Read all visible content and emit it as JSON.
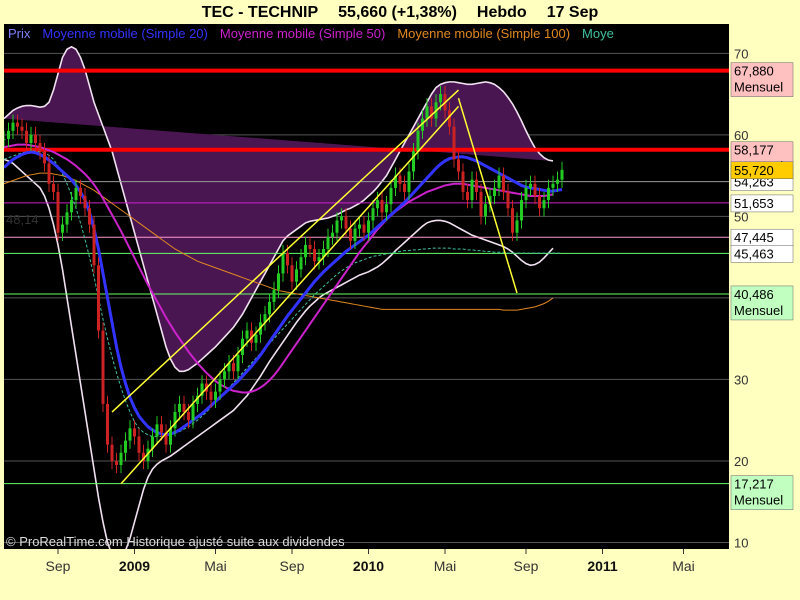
{
  "header": {
    "symbol": "TEC - TECHNIP",
    "quote": "55,660 (+1,38%)",
    "period": "Hebdo",
    "date": "17 Sep"
  },
  "legend": [
    {
      "label": "Prix",
      "color": "#8080FF"
    },
    {
      "label": "Moyenne mobile (Simple 20)",
      "color": "#3333FF"
    },
    {
      "label": "Moyenne mobile (Simple 50)",
      "color": "#CC22CC"
    },
    {
      "label": "Moyenne mobile (Simple 100)",
      "color": "#E08820"
    },
    {
      "label": "Moye",
      "color": "#40C0A0"
    }
  ],
  "footer": {
    "credit": "© ProRealTime.com Historique ajusté suite aux dividendes"
  },
  "colors": {
    "background": "#000000",
    "axis_bg": "#FFFFC0",
    "bollinger_fill": "#4A1652",
    "bollinger_edge": "#F0E0F0",
    "up": "#22CC22",
    "down": "#CC2222",
    "channel": "#FFFF33",
    "resistance": "#FF0000"
  },
  "chart_data": {
    "type": "candlestick",
    "ylim": [
      9.2,
      73.6
    ],
    "yticks": [
      10,
      20,
      30,
      40,
      50,
      60,
      70
    ],
    "xticks": [
      {
        "label": "Sep",
        "i": 12,
        "bold": false
      },
      {
        "label": "2009",
        "i": 29,
        "bold": true
      },
      {
        "label": "Mai",
        "i": 47,
        "bold": false
      },
      {
        "label": "Sep",
        "i": 64,
        "bold": false
      },
      {
        "label": "2010",
        "i": 81,
        "bold": true
      },
      {
        "label": "Mai",
        "i": 98,
        "bold": false
      },
      {
        "label": "Sep",
        "i": 116,
        "bold": false
      },
      {
        "label": "2011",
        "i": 133,
        "bold": true
      },
      {
        "label": "Mai",
        "i": 151,
        "bold": false
      }
    ],
    "prices": [
      59.5,
      60.5,
      61.5,
      61.0,
      60.5,
      59.0,
      60.0,
      59.0,
      58.0,
      56.5,
      54.0,
      53.0,
      48.0,
      49.0,
      50.5,
      52.0,
      53.5,
      52.5,
      51.0,
      49.0,
      44.0,
      36.0,
      27.0,
      22.0,
      20.0,
      19.5,
      21.0,
      22.5,
      24.0,
      23.0,
      21.0,
      20.0,
      21.5,
      23.0,
      24.5,
      23.5,
      22.0,
      24.0,
      26.0,
      27.0,
      26.0,
      25.0,
      27.0,
      28.0,
      29.5,
      28.5,
      27.5,
      28.5,
      30.0,
      31.0,
      32.0,
      31.0,
      33.0,
      35.0,
      36.0,
      34.5,
      35.5,
      37.0,
      38.0,
      39.5,
      41.0,
      43.0,
      45.5,
      44.0,
      42.0,
      43.5,
      45.0,
      46.5,
      46.0,
      44.5,
      45.0,
      46.0,
      47.5,
      48.0,
      49.5,
      50.0,
      48.5,
      47.0,
      48.5,
      49.0,
      48.0,
      49.5,
      51.0,
      52.0,
      50.5,
      51.5,
      53.5,
      55.0,
      54.0,
      53.0,
      55.5,
      58.0,
      60.5,
      62.0,
      63.5,
      62.0,
      64.0,
      65.0,
      63.0,
      61.0,
      57.0,
      55.5,
      53.0,
      52.0,
      54.5,
      53.0,
      50.0,
      51.5,
      52.5,
      53.5,
      55.0,
      53.0,
      51.0,
      48.0,
      49.5,
      52.0,
      53.5,
      54.0,
      52.5,
      51.0,
      52.0,
      53.5,
      54.0,
      54.5,
      55.7
    ],
    "sma20": [
      56.0,
      56.5,
      57.0,
      57.3,
      57.6,
      57.8,
      57.9,
      57.8,
      57.6,
      57.3,
      56.9,
      56.5,
      56.0,
      55.5,
      55.0,
      54.5,
      53.8,
      53.0,
      52.0,
      50.5,
      48.5,
      46.0,
      43.0,
      40.0,
      37.0,
      34.0,
      31.5,
      29.5,
      27.8,
      26.5,
      25.5,
      24.8,
      24.2,
      23.8,
      23.5,
      23.3,
      23.2,
      23.3,
      23.5,
      23.8,
      24.2,
      24.6,
      25.0,
      25.4,
      25.8,
      26.3,
      26.8,
      27.3,
      27.8,
      28.3,
      28.8,
      29.3,
      29.8,
      30.4,
      31.0,
      31.6,
      32.3,
      33.0,
      33.8,
      34.6,
      35.4,
      36.2,
      37.0,
      37.8,
      38.5,
      39.2,
      39.9,
      40.6,
      41.3,
      42.0,
      42.6,
      43.2,
      43.7,
      44.2,
      44.7,
      45.2,
      45.7,
      46.1,
      46.5,
      46.9,
      47.3,
      47.7,
      48.2,
      48.7,
      49.2,
      49.7,
      50.2,
      50.7,
      51.2,
      51.7,
      52.3,
      52.9,
      53.5,
      54.1,
      54.7,
      55.3,
      55.9,
      56.4,
      56.8,
      57.1,
      57.2,
      57.3,
      57.3,
      57.2,
      57.0,
      56.8,
      56.5,
      56.2,
      55.9,
      55.6,
      55.3,
      55.0,
      54.7,
      54.4,
      54.1,
      53.8,
      53.6,
      53.5,
      53.4,
      53.3,
      53.2,
      53.1,
      53.1,
      53.2,
      53.3
    ],
    "sma50": [
      58.5,
      58.6,
      58.7,
      58.8,
      58.8,
      58.8,
      58.7,
      58.6,
      58.5,
      58.3,
      58.1,
      57.9,
      57.6,
      57.3,
      57.0,
      56.6,
      56.2,
      55.7,
      55.2,
      54.6,
      53.9,
      53.1,
      52.2,
      51.2,
      50.2,
      49.2,
      48.2,
      47.1,
      46.0,
      44.9,
      43.8,
      42.7,
      41.6,
      40.6,
      39.6,
      38.6,
      37.6,
      36.7,
      35.8,
      35.0,
      34.2,
      33.4,
      32.7,
      32.0,
      31.4,
      30.8,
      30.3,
      29.8,
      29.4,
      29.1,
      28.8,
      28.6,
      28.5,
      28.4,
      28.4,
      28.5,
      28.7,
      29.0,
      29.4,
      29.9,
      30.5,
      31.2,
      32.0,
      32.8,
      33.6,
      34.4,
      35.2,
      36.0,
      36.8,
      37.6,
      38.4,
      39.2,
      40.0,
      40.8,
      41.6,
      42.4,
      43.2,
      44.0,
      44.8,
      45.6,
      46.3,
      47.0,
      47.7,
      48.4,
      49.0,
      49.6,
      50.1,
      50.6,
      51.0,
      51.4,
      51.8,
      52.1,
      52.4,
      52.7,
      53.0,
      53.2,
      53.4,
      53.6,
      53.8,
      53.9,
      54.0,
      54.0,
      54.0,
      53.9,
      53.8,
      53.7,
      53.6,
      53.5,
      53.4,
      53.3,
      53.2,
      53.1,
      53.0,
      52.9,
      52.8,
      52.7,
      52.6,
      52.5,
      52.5,
      52.5,
      52.5,
      52.6,
      52.7
    ],
    "sma100": [
      54.0,
      54.2,
      54.4,
      54.6,
      54.8,
      55.0,
      55.1,
      55.2,
      55.3,
      55.3,
      55.3,
      55.2,
      55.1,
      55.0,
      54.8,
      54.6,
      54.4,
      54.1,
      53.8,
      53.5,
      53.2,
      52.8,
      52.4,
      52.0,
      51.6,
      51.2,
      50.8,
      50.4,
      50.0,
      49.6,
      49.2,
      48.8,
      48.4,
      48.0,
      47.6,
      47.2,
      46.8,
      46.4,
      46.0,
      45.7,
      45.4,
      45.1,
      44.8,
      44.5,
      44.3,
      44.1,
      43.9,
      43.7,
      43.5,
      43.3,
      43.1,
      42.9,
      42.7,
      42.5,
      42.3,
      42.1,
      41.9,
      41.7,
      41.5,
      41.3,
      41.1,
      40.9,
      40.8,
      40.7,
      40.6,
      40.5,
      40.4,
      40.3,
      40.2,
      40.1,
      40.0,
      39.9,
      39.8,
      39.7,
      39.6,
      39.5,
      39.4,
      39.3,
      39.2,
      39.1,
      39.0,
      38.9,
      38.8,
      38.7,
      38.6,
      38.6,
      38.6,
      38.6,
      38.6,
      38.6,
      38.6,
      38.6,
      38.6,
      38.6,
      38.6,
      38.6,
      38.6,
      38.6,
      38.6,
      38.6,
      38.6,
      38.6,
      38.6,
      38.6,
      38.6,
      38.6,
      38.6,
      38.6,
      38.6,
      38.6,
      38.6,
      38.5,
      38.5,
      38.5,
      38.5,
      38.6,
      38.7,
      38.8,
      38.9,
      39.1,
      39.3,
      39.6,
      40.0
    ],
    "ma_other": [
      57.0,
      57.2,
      57.4,
      57.6,
      57.8,
      57.9,
      58.0,
      58.0,
      57.9,
      57.8,
      57.5,
      57.0,
      56.2,
      55.2,
      54.0,
      52.6,
      51.0,
      49.2,
      47.2,
      45.0,
      42.6,
      40.0,
      37.4,
      35.0,
      32.8,
      30.8,
      29.0,
      27.4,
      26.0,
      24.8,
      24.0,
      23.5,
      23.2,
      23.0,
      23.0,
      23.0,
      23.1,
      23.2,
      23.4,
      23.6,
      23.9,
      24.2,
      24.6,
      25.0,
      25.5,
      26.0,
      26.6,
      27.2,
      27.8,
      28.4,
      29.0,
      29.6,
      30.2,
      30.8,
      31.4,
      32.0,
      32.6,
      33.2,
      33.8,
      34.4,
      35.0,
      35.6,
      36.2,
      36.8,
      37.4,
      38.0,
      38.6,
      39.2,
      39.8,
      40.4,
      40.9,
      41.4,
      41.9,
      42.4,
      42.9,
      43.3,
      43.7,
      44.0,
      44.3,
      44.5,
      44.7,
      44.9,
      45.1,
      45.2,
      45.3,
      45.4,
      45.5,
      45.6,
      45.7,
      45.8,
      45.8,
      45.9,
      45.9,
      46.0,
      46.0,
      46.1,
      46.1,
      46.1,
      46.1,
      46.1,
      46.0,
      46.0,
      46.0,
      45.9,
      45.9,
      45.8,
      45.8,
      45.7,
      45.7,
      45.6,
      45.6,
      45.6,
      45.5,
      45.5,
      45.5,
      45.5,
      45.5,
      45.5,
      45.5,
      45.5,
      45.5,
      45.5,
      45.5,
      45.5,
      45.5
    ],
    "bb_upper": [
      62.0,
      62.5,
      63.0,
      63.3,
      63.5,
      63.6,
      63.6,
      63.5,
      63.4,
      63.5,
      64.0,
      65.5,
      67.5,
      69.5,
      70.5,
      70.8,
      70.5,
      69.5,
      68.0,
      66.0,
      64.0,
      62.5,
      61.0,
      59.5,
      58.0,
      56.0,
      54.0,
      52.0,
      50.0,
      48.0,
      46.0,
      44.0,
      42.0,
      40.0,
      38.0,
      36.0,
      34.0,
      32.5,
      31.5,
      31.0,
      31.0,
      31.2,
      31.6,
      32.0,
      32.5,
      33.0,
      33.5,
      34.0,
      34.6,
      35.2,
      35.8,
      36.4,
      37.2,
      38.0,
      39.0,
      40.0,
      41.0,
      42.0,
      43.0,
      44.0,
      45.0,
      46.0,
      47.0,
      47.6,
      48.0,
      48.4,
      48.8,
      49.2,
      49.4,
      49.5,
      49.6,
      49.7,
      49.8,
      50.0,
      50.2,
      50.5,
      50.8,
      51.0,
      51.3,
      51.6,
      52.0,
      52.5,
      53.0,
      53.6,
      54.3,
      55.0,
      56.0,
      57.0,
      58.0,
      59.0,
      60.0,
      61.0,
      62.0,
      63.0,
      64.0,
      65.0,
      65.8,
      66.2,
      66.4,
      66.5,
      66.5,
      66.4,
      66.3,
      66.2,
      66.2,
      66.3,
      66.4,
      66.5,
      66.4,
      66.2,
      65.8,
      65.3,
      64.6,
      63.8,
      62.8,
      61.7,
      60.5,
      59.4,
      58.4,
      57.7,
      57.2,
      56.9,
      56.8
    ],
    "bb_lower": [
      57.0,
      56.8,
      56.5,
      56.0,
      55.5,
      55.0,
      54.5,
      54.0,
      53.5,
      52.5,
      51.0,
      49.0,
      46.5,
      43.5,
      40.0,
      36.5,
      33.0,
      29.5,
      26.0,
      22.5,
      19.0,
      15.5,
      12.5,
      10.0,
      8.5,
      8.0,
      8.2,
      9.0,
      10.5,
      12.5,
      14.5,
      16.5,
      18.0,
      19.0,
      19.6,
      20.0,
      20.3,
      20.6,
      21.0,
      21.4,
      21.8,
      22.2,
      22.6,
      23.0,
      23.4,
      23.8,
      24.2,
      24.6,
      25.0,
      25.4,
      25.8,
      26.2,
      26.8,
      27.4,
      28.0,
      28.8,
      29.6,
      30.4,
      31.3,
      32.2,
      33.0,
      33.8,
      34.6,
      35.4,
      36.2,
      37.0,
      37.7,
      38.4,
      39.0,
      39.5,
      40.0,
      40.4,
      40.7,
      41.0,
      41.3,
      41.6,
      41.9,
      42.2,
      42.5,
      42.8,
      43.0,
      43.2,
      43.5,
      43.8,
      44.2,
      44.7,
      45.2,
      45.8,
      46.3,
      46.8,
      47.3,
      47.8,
      48.3,
      48.8,
      49.2,
      49.4,
      49.5,
      49.5,
      49.4,
      49.2,
      48.9,
      48.6,
      48.3,
      48.0,
      47.7,
      47.5,
      47.3,
      47.1,
      46.9,
      46.7,
      46.5,
      46.3,
      46.0,
      45.6,
      45.1,
      44.6,
      44.2,
      44.0,
      44.1,
      44.4,
      44.9,
      45.5,
      46.1
    ],
    "hlines": [
      {
        "value": 67.88,
        "label": "67,880",
        "sub": "Mensuel",
        "color": "#FF0000",
        "width": 4,
        "tag_bg": "#FFC0C0"
      },
      {
        "value": 58.177,
        "label": "58,177",
        "sub": "Mensuel",
        "color": "#FF0000",
        "width": 4,
        "tag_bg": "#FFC0C0"
      },
      {
        "value": 54.263,
        "label": "54,263",
        "sub": "",
        "color": "#999999",
        "width": 1,
        "tag_bg": "#FFFFFF"
      },
      {
        "value": 51.653,
        "label": "51,653",
        "sub": "",
        "color": "#CC22CC",
        "width": 1,
        "tag_bg": "#FFFFFF"
      },
      {
        "value": 47.445,
        "label": "47,445",
        "sub": "",
        "color": "#FF99CC",
        "width": 1,
        "tag_bg": "#FFFFFF"
      },
      {
        "value": 45.463,
        "label": "45,463",
        "sub": "",
        "color": "#66FF66",
        "width": 1,
        "tag_bg": "#FFFFFF"
      },
      {
        "value": 40.486,
        "label": "40,486",
        "sub": "Mensuel",
        "color": "#66FF66",
        "width": 1,
        "tag_bg": "#C0FFC0"
      },
      {
        "value": 17.217,
        "label": "17,217",
        "sub": "Mensuel",
        "color": "#66FF66",
        "width": 1,
        "tag_bg": "#C0FFC0"
      },
      {
        "value": 55.72,
        "label": "55,720",
        "sub": "",
        "color": "#FFCC00",
        "width": 0,
        "tag_bg": "#FFCC00"
      }
    ],
    "left_label": {
      "text": "48,14",
      "value": 49.7
    },
    "channel": [
      {
        "from": [
          26,
          17.2
        ],
        "to": [
          101,
          63.5
        ]
      },
      {
        "from": [
          24,
          26.0
        ],
        "to": [
          101,
          65.5
        ]
      },
      {
        "from": [
          101,
          64.5
        ],
        "to": [
          114,
          40.6
        ]
      }
    ]
  }
}
